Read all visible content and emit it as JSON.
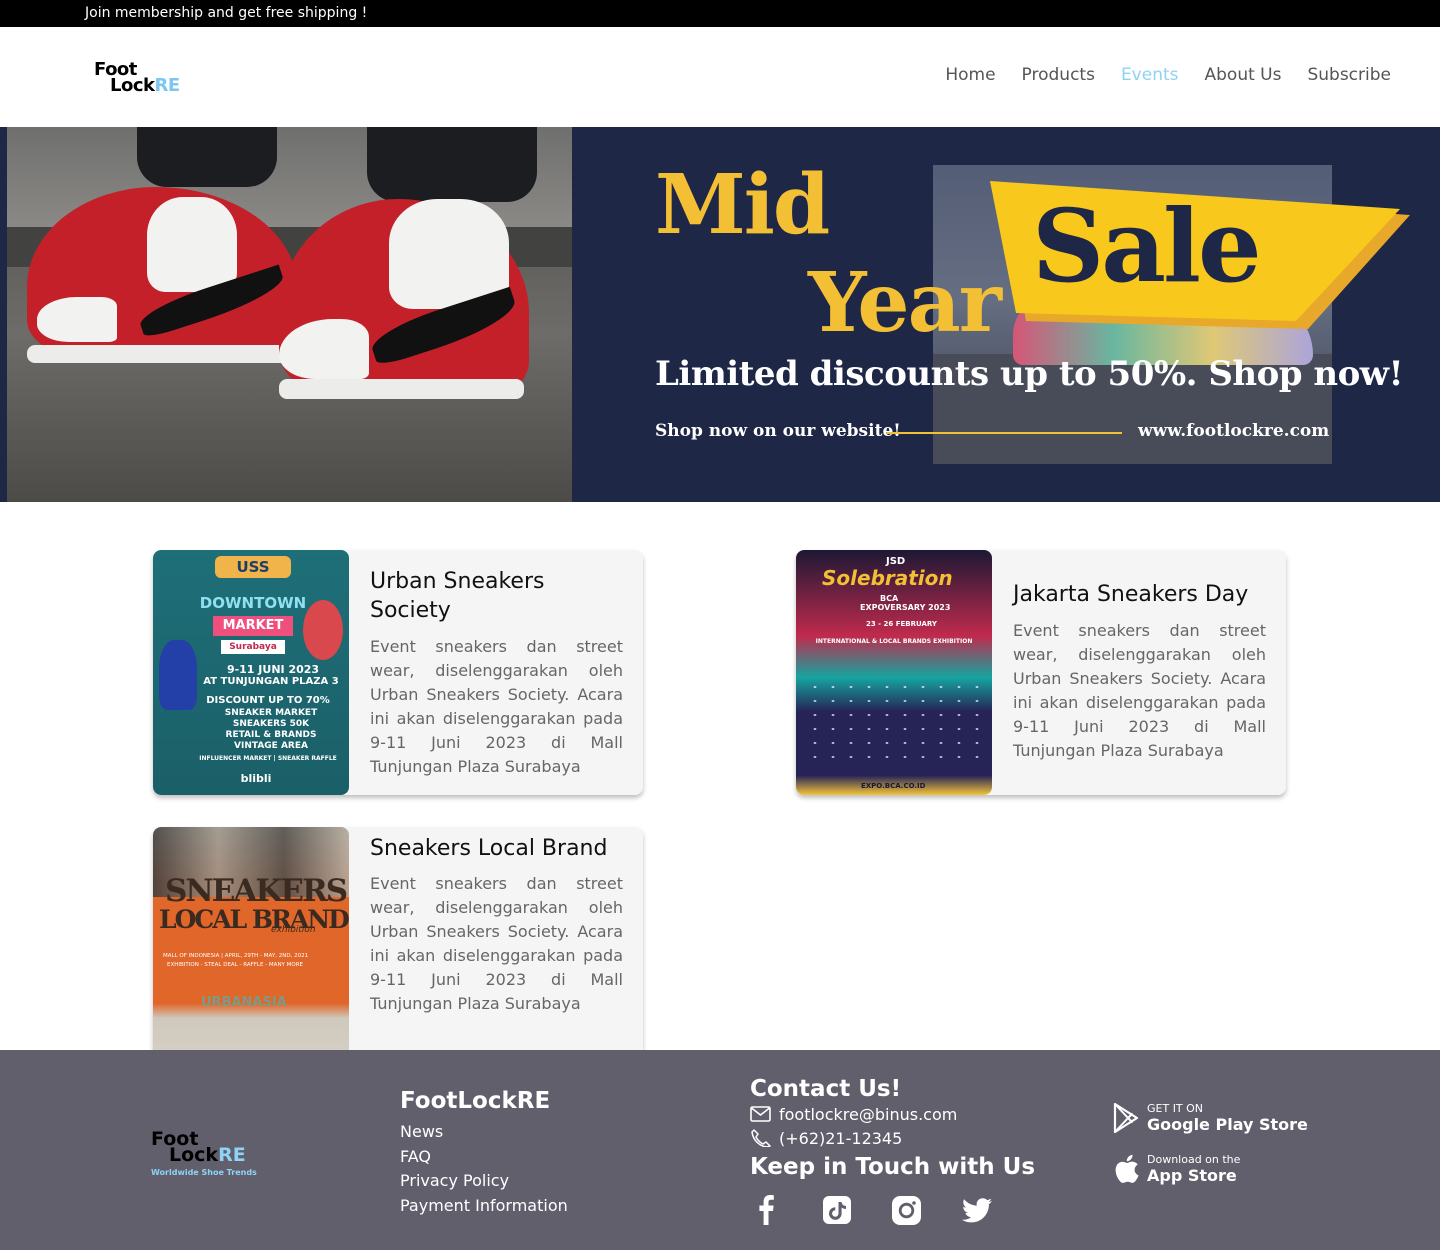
{
  "topbar": {
    "text": "Join membership and get free shipping !"
  },
  "header": {
    "logo": {
      "line1": "Foot",
      "line2": "Lock",
      "re": "RE"
    },
    "nav": [
      {
        "label": "Home",
        "active": false
      },
      {
        "label": "Products",
        "active": false
      },
      {
        "label": "Events",
        "active": true
      },
      {
        "label": "About Us",
        "active": false
      },
      {
        "label": "Subscribe",
        "active": false
      }
    ]
  },
  "banner": {
    "mid": "Mid",
    "year": "Year",
    "sale": "Sale",
    "tagline": "Limited discounts up to 50%. Shop now!",
    "shopline": "Shop now on our website!",
    "url": "www.footlockre.com"
  },
  "events": [
    {
      "title": "Urban Sneakers Society",
      "description": "Event sneakers dan street wear, diselenggarakan oleh Urban Sneakers Society. Acara ini akan diselenggarakan pada 9-11 Juni 2023 di Mall Tunjungan Plaza Surabaya",
      "poster": {
        "top": "USS",
        "line1": "DOWNTOWN",
        "line2": "MARKET",
        "city": "Surabaya",
        "dates": "9-11 JUNI 2023",
        "venue": "AT TUNJUNGAN PLAZA 3",
        "discount": "DISCOUNT UP TO 70%",
        "items": [
          "SNEAKER MARKET",
          "SNEAKERS 50K",
          "RETAIL & BRANDS",
          "VINTAGE AREA"
        ],
        "footer": "INFLUENCER MARKET | SNEAKER RAFFLE",
        "sponsor": "blibli"
      }
    },
    {
      "title": "Jakarta Sneakers Day",
      "description": "Event sneakers dan street wear, diselenggarakan oleh Urban Sneakers Society. Acara ini akan diselenggarakan pada 9-11 Juni 2023 di Mall Tunjungan Plaza Surabaya",
      "poster": {
        "top": "JSD",
        "name": "Solebration",
        "sponsor": "BCA",
        "event": "EXPOVERSARY 2023",
        "dates": "23 - 26 FEBRUARY",
        "headline": "INTERNATIONAL & LOCAL BRANDS EXHIBITION",
        "url": "EXPO.BCA.CO.ID"
      }
    },
    {
      "title": "Sneakers Local Brand",
      "description": "Event sneakers dan street wear, diselenggarakan oleh Urban Sneakers Society. Acara ini akan diselenggarakan pada 9-11 Juni 2023 di Mall Tunjungan Plaza Surabaya",
      "poster": {
        "line1": "SNEAKERS",
        "line2": "LOCAL BRANDS",
        "sub": "exhibition",
        "info1": "MALL OF INDONESIA | APRIL, 29TH - MAY, 2ND, 2021",
        "info2": "EXHIBITION - STEAL DEAL - RAFFLE - MANY MORE",
        "brand": "URBANASIA"
      }
    }
  ],
  "footer": {
    "logo": {
      "line1": "Foot",
      "line2": "Lock",
      "re": "RE",
      "tagline": "Worldwide Shoe Trends"
    },
    "brand_heading": "FootLockRE",
    "links": [
      "News",
      "FAQ",
      "Privacy Policy",
      "Payment Information"
    ],
    "contact_heading": "Contact Us!",
    "email": "footlockre@binus.com",
    "phone": "(+62)21-12345",
    "social_heading": "Keep in Touch with Us",
    "socials": [
      "facebook-icon",
      "tiktok-icon",
      "instagram-icon",
      "twitter-icon"
    ],
    "stores": [
      {
        "small": "GET IT ON",
        "big": "Google Play Store",
        "icon": "google-play-icon"
      },
      {
        "small": "Download on the",
        "big": "App Store",
        "icon": "apple-icon"
      }
    ]
  }
}
